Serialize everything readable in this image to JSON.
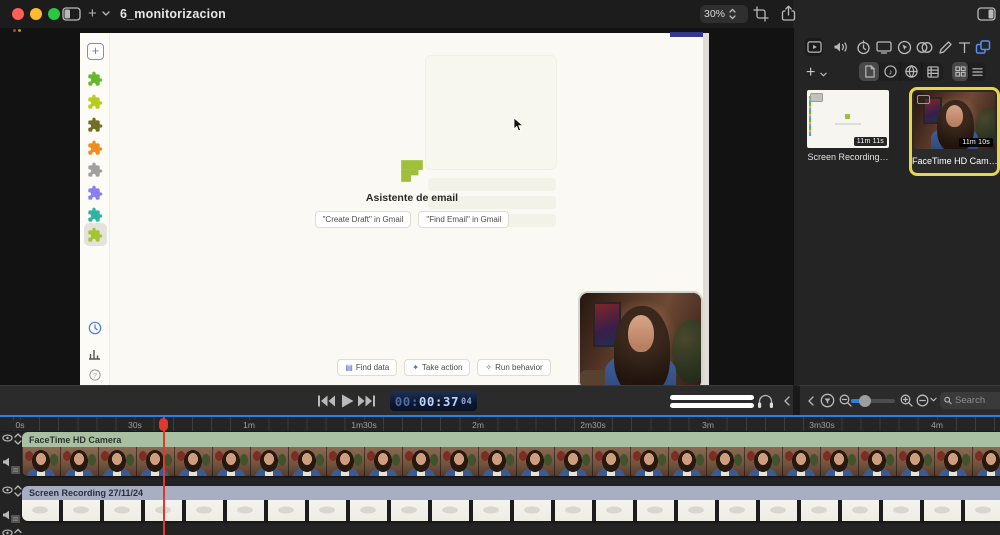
{
  "titlebar": {
    "title": "6_monitorizacion",
    "zoom_value": "30%"
  },
  "canvas": {
    "recorded_app": {
      "assistant_title": "Asistente de email",
      "action_chips": [
        "\"Create Draft\" in Gmail",
        "\"Find Email\" in Gmail"
      ],
      "footer_actions": [
        "Find data",
        "Take action",
        "Run behavior"
      ]
    }
  },
  "transport": {
    "timecode": {
      "hours": "00:",
      "main": "00:37",
      "frames": "04"
    }
  },
  "media_panel": {
    "items": [
      {
        "label": "Screen Recording…",
        "duration": "11m 11s"
      },
      {
        "label": "FaceTime HD Cam…",
        "duration": "11m 10s"
      }
    ],
    "search_placeholder": "Search"
  },
  "timeline": {
    "ruler_labels": [
      "0s",
      "30s",
      "1m",
      "1m30s",
      "2m",
      "2m30s",
      "3m",
      "3m30s",
      "4m"
    ],
    "tracks": [
      {
        "name": "FaceTime HD Camera"
      },
      {
        "name": "Screen Recording 27/11/24"
      }
    ]
  },
  "colors": {
    "selection_yellow": "#e8d44f",
    "playhead_red": "#e0382e",
    "accent_blue": "#2f7fe0",
    "timecode_blue": "#bdd4fb",
    "facetime_clip_green": "#a9c0a3",
    "screen_clip_gray": "#a9afc2"
  }
}
